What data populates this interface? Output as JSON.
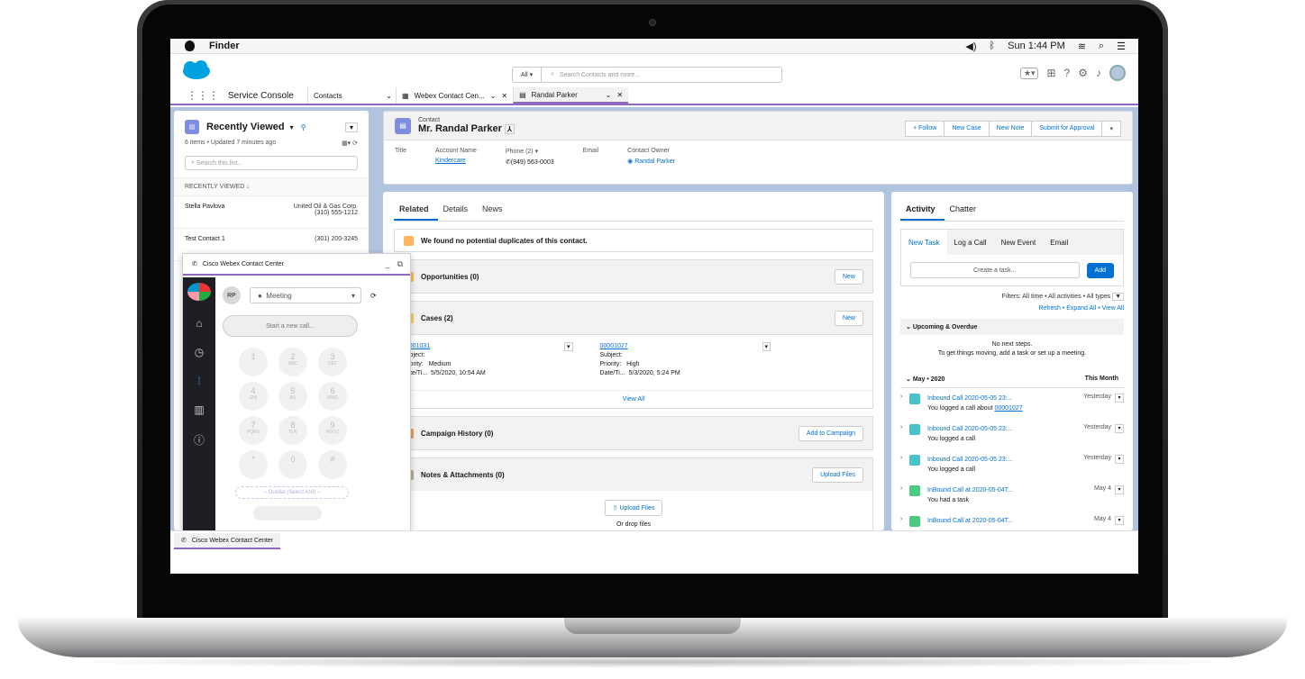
{
  "menubar": {
    "app": "Finder",
    "time": "Sun 1:44 PM"
  },
  "header": {
    "search_scope": "All",
    "search_placeholder": "Search Contacts and more..."
  },
  "nav": {
    "app_name": "Service Console",
    "object": "Contacts",
    "tabs": [
      "Webex Contact Cen...",
      "Randal Parker"
    ]
  },
  "left_panel": {
    "title": "Recently Viewed",
    "meta": "6 items • Updated 7 minutes ago",
    "search_placeholder": "Search this list...",
    "section": "RECENTLY VIEWED",
    "rows": [
      {
        "name": "Stella Pavlova",
        "company": "United Oil & Gas Corp.",
        "phone": "(310) 555-1212"
      },
      {
        "name": "Test Contact 1",
        "company": "",
        "phone": "(301) 200-3245"
      }
    ]
  },
  "record": {
    "type": "Contact",
    "name": "Mr. Randal Parker",
    "buttons": [
      "+ Follow",
      "New Case",
      "New Note",
      "Submit for Approval"
    ],
    "fields": [
      {
        "label": "Title",
        "value": ""
      },
      {
        "label": "Account Name",
        "value": "Kindercare"
      },
      {
        "label": "Phone (2)",
        "value": "(949) 563-0003"
      },
      {
        "label": "Email",
        "value": ""
      },
      {
        "label": "Contact Owner",
        "value": "Randal Parker"
      }
    ]
  },
  "related": {
    "tabs": [
      "Related",
      "Details",
      "News"
    ],
    "duplicates": "We found no potential duplicates of this contact.",
    "opportunities": {
      "title": "Opportunities (0)",
      "button": "New"
    },
    "cases": {
      "title": "Cases (2)",
      "button": "New",
      "view_all": "View All",
      "items": [
        {
          "number": "00001031",
          "priority": "Medium",
          "date": "5/5/2020, 10:54 AM"
        },
        {
          "number": "00001027",
          "priority": "High",
          "date": "5/3/2020, 5:24 PM"
        }
      ],
      "labels": {
        "subject": "Subject:",
        "priority": "Priority:",
        "date": "Date/Ti..."
      }
    },
    "campaign": {
      "title": "Campaign History (0)",
      "button": "Add to Campaign"
    },
    "notes": {
      "title": "Notes & Attachments (0)",
      "button": "Upload Files",
      "upload": "Upload Files",
      "drop": "Or drop files"
    }
  },
  "activity": {
    "tabs": [
      "Activity",
      "Chatter"
    ],
    "subtabs": [
      "New Task",
      "Log a Call",
      "New Event",
      "Email"
    ],
    "task_placeholder": "Create a task...",
    "add": "Add",
    "filters": "Filters: All time • All activities • All types",
    "links": "Refresh • Expand All • View All",
    "upcoming": "Upcoming & Overdue",
    "no_steps_1": "No next steps.",
    "no_steps_2": "To get things moving, add a task or set up a meeting.",
    "month": "May • 2020",
    "this_month": "This Month",
    "items": [
      {
        "title": "Inbound Call 2020-05-05 23:...",
        "sub": "You logged a call about",
        "link": "00001027",
        "when": "Yesterday",
        "color": "#48c3cc"
      },
      {
        "title": "Inbound Call 2020-05-05 23:...",
        "sub": "You logged a call",
        "link": "",
        "when": "Yesterday",
        "color": "#48c3cc"
      },
      {
        "title": "Inbound Call 2020-05-05 23:...",
        "sub": "You logged a call",
        "link": "",
        "when": "Yesterday",
        "color": "#48c3cc"
      },
      {
        "title": "InBound Call at 2020-05-04T...",
        "sub": "You had a task",
        "link": "",
        "when": "May 4",
        "color": "#4bca81"
      },
      {
        "title": "InBound Call at 2020-05-04T...",
        "sub": "",
        "link": "",
        "when": "May 4",
        "color": "#4bca81"
      }
    ]
  },
  "webex": {
    "title": "Cisco Webex Contact Center",
    "initials": "RP",
    "state": "Meeting",
    "new_call": "Start a new call...",
    "outdial": "-- Outdial (Select ANI) --",
    "keys": [
      [
        "1",
        ""
      ],
      [
        "2",
        "ABC"
      ],
      [
        "3",
        "DEF"
      ],
      [
        "4",
        "GHI"
      ],
      [
        "5",
        "JKL"
      ],
      [
        "6",
        "MNO"
      ],
      [
        "7",
        "PQRS"
      ],
      [
        "8",
        "TUV"
      ],
      [
        "9",
        "WXYZ"
      ],
      [
        "*",
        ""
      ],
      [
        "0",
        ""
      ],
      [
        "#",
        ""
      ]
    ]
  },
  "utility": {
    "label": "Cisco Webex Contact Center"
  }
}
